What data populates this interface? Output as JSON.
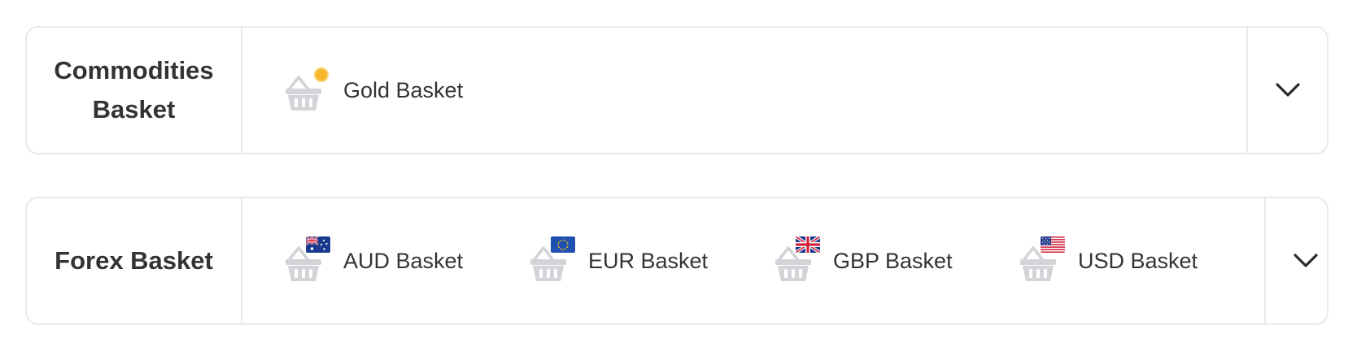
{
  "sections": [
    {
      "title": "Commodities Basket",
      "items": [
        {
          "label": "Gold Basket",
          "icon": "gold-coin"
        }
      ]
    },
    {
      "title": "Forex Basket",
      "items": [
        {
          "label": "AUD Basket",
          "icon": "australia-flag"
        },
        {
          "label": "EUR Basket",
          "icon": "eu-flag"
        },
        {
          "label": "GBP Basket",
          "icon": "uk-flag"
        },
        {
          "label": "USD Basket",
          "icon": "us-flag"
        }
      ]
    }
  ],
  "colors": {
    "border": "#e9e9ec",
    "text": "#333333",
    "basket": "#d3d3d8",
    "gold": "#f5b72b"
  }
}
